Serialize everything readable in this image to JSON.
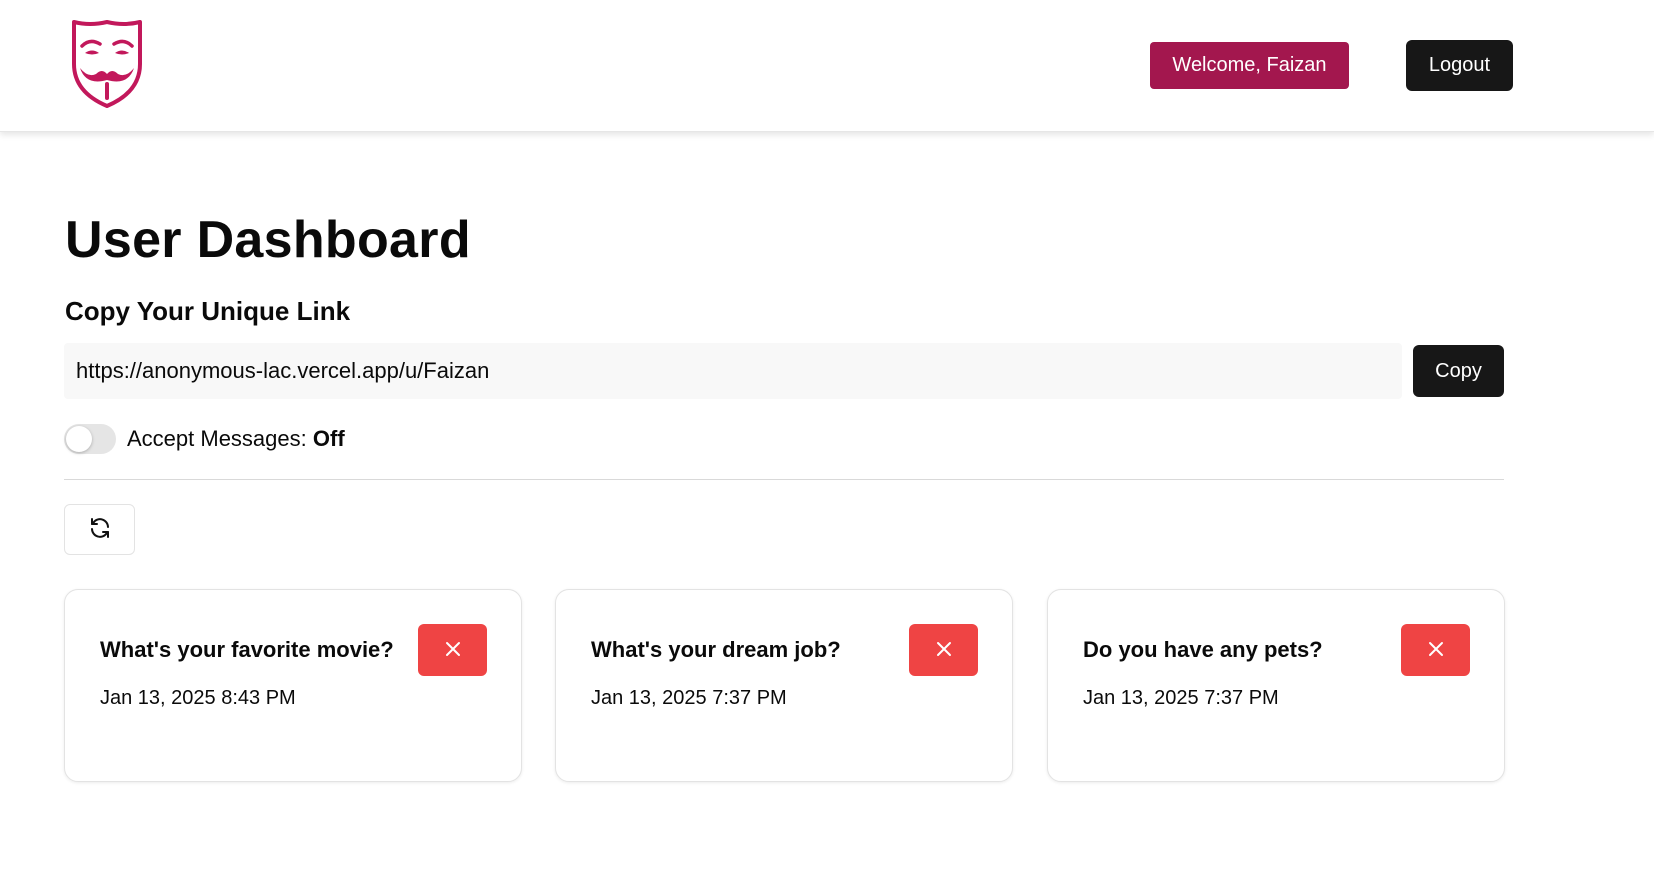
{
  "header": {
    "logo_icon": "anonymous-mask-icon",
    "welcome_label": "Welcome, Faizan",
    "logout_label": "Logout"
  },
  "main": {
    "title": "User Dashboard",
    "link_section_title": "Copy Your Unique Link",
    "unique_link": "https://anonymous-lac.vercel.app/u/Faizan",
    "copy_label": "Copy",
    "accept_messages": {
      "label": "Accept Messages: ",
      "state": "Off",
      "enabled": false
    },
    "refresh_icon": "refresh-icon"
  },
  "messages": [
    {
      "question": "What's your favorite movie?",
      "date": "Jan 13, 2025 8:43 PM"
    },
    {
      "question": "What's your dream job?",
      "date": "Jan 13, 2025 7:37 PM"
    },
    {
      "question": "Do you have any pets?",
      "date": "Jan 13, 2025 7:37 PM"
    }
  ],
  "colors": {
    "brand": "#a3174e",
    "dark_button": "#171717",
    "delete": "#ef4444"
  }
}
